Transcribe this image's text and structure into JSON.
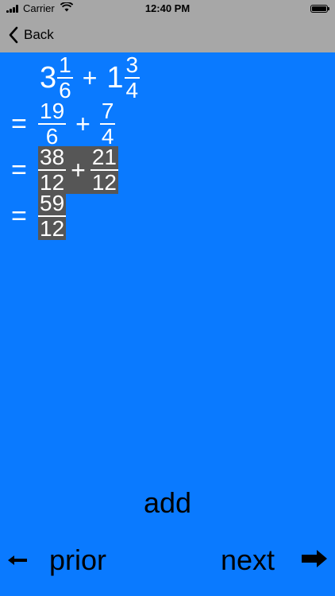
{
  "status_bar": {
    "carrier": "Carrier",
    "time": "12:40 PM"
  },
  "nav": {
    "back_label": "Back"
  },
  "math": {
    "line1": {
      "w1": "3",
      "n1": "1",
      "d1": "6",
      "op": "+",
      "w2": "1",
      "n2": "3",
      "d2": "4"
    },
    "line2": {
      "eq": "=",
      "n1": "19",
      "d1": "6",
      "op": "+",
      "n2": "7",
      "d2": "4"
    },
    "line3": {
      "eq": "=",
      "n1": "38",
      "d1": "12",
      "op": "+",
      "n2": "21",
      "d2": "12"
    },
    "line4": {
      "eq": "=",
      "n1": "59",
      "d1": "12"
    }
  },
  "operation_label": "add",
  "controls": {
    "prior_label": "prior",
    "next_label": "next",
    "left_icon": "left-arrow-icon",
    "right_icon": "right-arrow-icon"
  },
  "colors": {
    "background": "#0A7AFF",
    "header": "#A7A7A7",
    "highlight": "#565656"
  }
}
